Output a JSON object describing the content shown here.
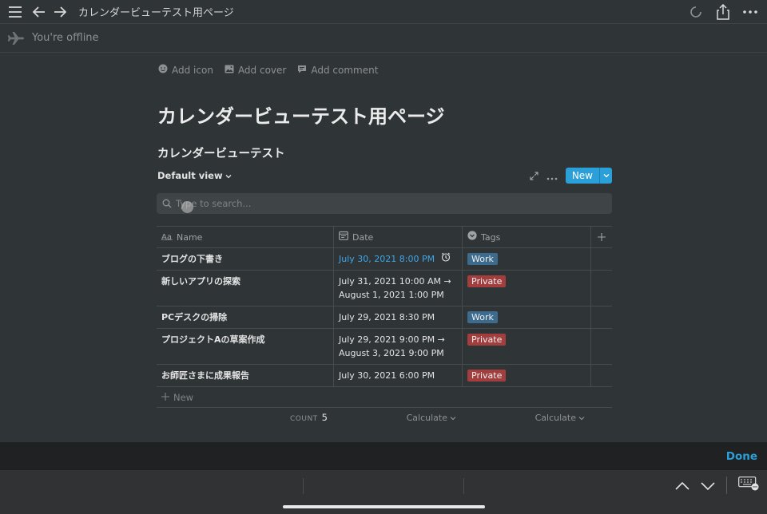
{
  "topbar": {
    "title": "カレンダービューテスト用ページ"
  },
  "offline": {
    "text": "You're offline"
  },
  "page_actions": {
    "add_icon": "Add icon",
    "add_cover": "Add cover",
    "add_comment": "Add comment"
  },
  "page": {
    "title": "カレンダービューテスト用ページ"
  },
  "database": {
    "title": "カレンダービューテスト",
    "view": "Default view",
    "new_label": "New",
    "search_placeholder": "Type to search...",
    "columns": {
      "name": "Name",
      "date": "Date",
      "tags": "Tags"
    },
    "rows": [
      {
        "name": "ブログの下書き",
        "date1": "July 30, 2021 8:00 PM",
        "date2": "",
        "tag": "Work"
      },
      {
        "name": "新しいアプリの探索",
        "date1": "July 31, 2021 10:00 AM →",
        "date2": "August 1, 2021 1:00 PM",
        "tag": "Private"
      },
      {
        "name": "PCデスクの掃除",
        "date1": "July 29, 2021 8:30 PM",
        "date2": "",
        "tag": "Work"
      },
      {
        "name": "プロジェクトAの草案作成",
        "date1": "July 29, 2021 9:00 PM →",
        "date2": "August 3, 2021 9:00 PM",
        "tag": "Private"
      },
      {
        "name": "お師匠さまに成果報告",
        "date1": "July 30, 2021 6:00 PM",
        "date2": "",
        "tag": "Private"
      }
    ],
    "new_row": "New",
    "count_label": "COUNT",
    "count_value": "5",
    "calculate_label": "Calculate"
  },
  "done_bar": {
    "done": "Done"
  },
  "colors": {
    "accent": "#2a9fd8",
    "work_tag": "#3c6b8e",
    "private_tag": "#a33e3e",
    "background": "#2f3437"
  }
}
